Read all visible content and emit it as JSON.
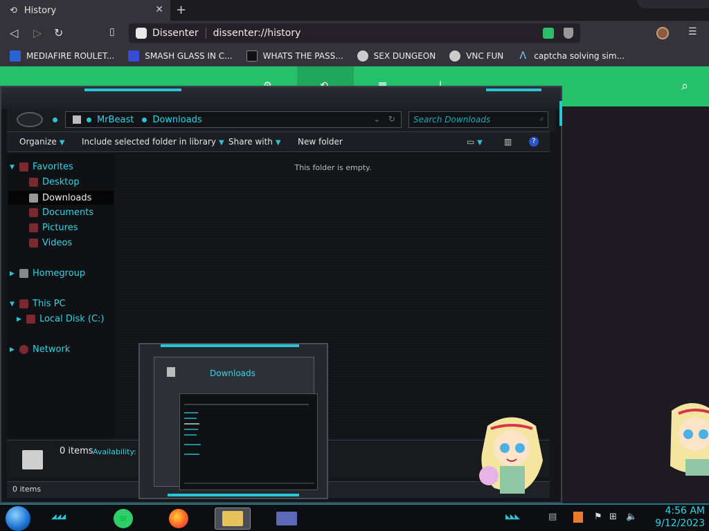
{
  "browser": {
    "tab_title": "History",
    "site_name": "Dissenter",
    "url": "dissenter://history",
    "bookmarks": [
      {
        "label": "MEDIAFIRE ROULET...",
        "icon": "mediafire-icon"
      },
      {
        "label": "SMASH GLASS IN C...",
        "icon": "smash-icon"
      },
      {
        "label": "WHATS THE PASS...",
        "icon": "mask-icon"
      },
      {
        "label": "SEX DUNGEON",
        "icon": "gear-icon"
      },
      {
        "label": "VNC FUN",
        "icon": "gear-icon"
      },
      {
        "label": "captcha solving sim...",
        "icon": "lambda-icon"
      }
    ]
  },
  "explorer": {
    "breadcrumb": [
      "MrBeast",
      "Downloads"
    ],
    "search_placeholder": "Search Downloads",
    "commands": [
      {
        "label": "Organize",
        "dropdown": true
      },
      {
        "label": "Include selected folder in library",
        "dropdown": true
      },
      {
        "label": "Share with",
        "dropdown": true
      },
      {
        "label": "New folder",
        "dropdown": false
      }
    ],
    "nav": {
      "favorites": "Favorites",
      "desktop": "Desktop",
      "downloads": "Downloads",
      "documents": "Documents",
      "pictures": "Pictures",
      "videos": "Videos",
      "homegroup": "Homegroup",
      "this_pc": "This PC",
      "local_disk": "Local Disk (C:)",
      "network": "Network"
    },
    "empty_message": "This folder is empty.",
    "details_count": "0 items",
    "details_availability": "Availability:",
    "status_count": "0 items"
  },
  "preview": {
    "title": "Downloads"
  },
  "clock": {
    "time": "4:56 AM",
    "date": "9/12/2023"
  },
  "colors": {
    "accent": "#2ec4d4",
    "header_green": "#25c16a"
  }
}
